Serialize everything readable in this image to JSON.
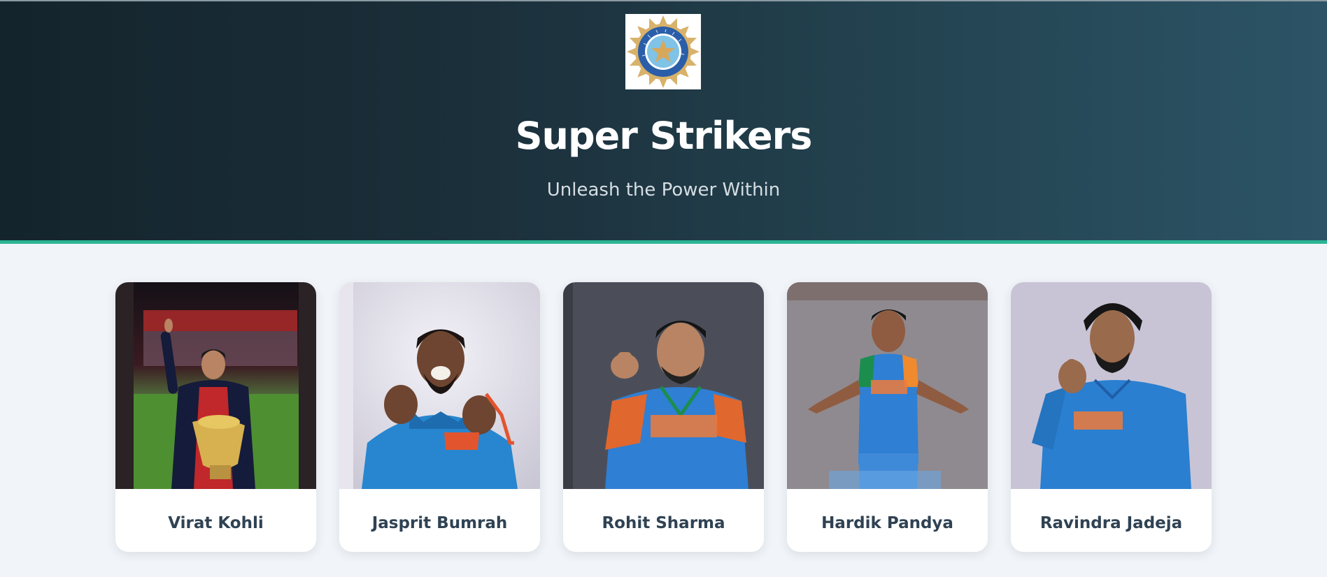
{
  "hero": {
    "logo_icon": "bcci-crest-icon",
    "logo_lettering": "BOARD OF CONTROL FOR CRICKET IN INDIA",
    "title": "Super Strikers",
    "subtitle": "Unleash the Power Within"
  },
  "players": [
    {
      "name": "Virat Kohli"
    },
    {
      "name": "Jasprit Bumrah"
    },
    {
      "name": "Rohit Sharma"
    },
    {
      "name": "Hardik Pandya"
    },
    {
      "name": "Ravindra Jadeja"
    }
  ],
  "colors": {
    "hero_start": "#14242c",
    "hero_end": "#2c5466",
    "accent": "#2bb594",
    "name_text": "#2f4253",
    "page_bg": "#f1f4f8"
  }
}
